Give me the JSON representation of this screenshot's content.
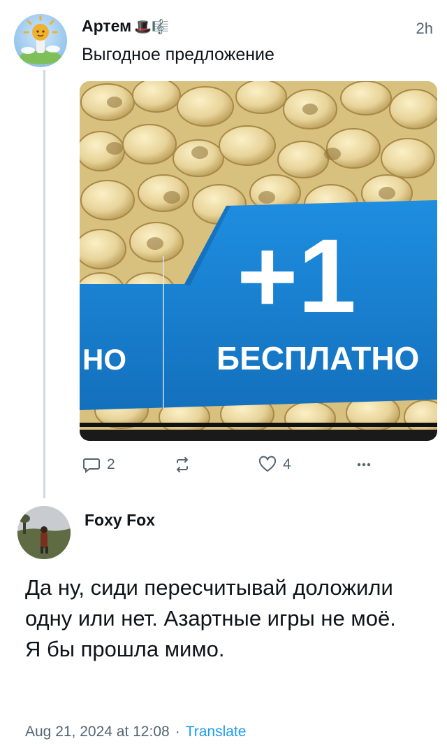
{
  "post": {
    "author": "Артем",
    "author_emoji": "🎩🎼",
    "time": "2h",
    "text": "Выгодное предложение",
    "image": {
      "promo_plus": "+1",
      "promo_label": "БЕСПЛАТНО",
      "promo_left_fragment": "НО",
      "colors": {
        "banner": "#1a82d2",
        "pasta": "#e8d49a"
      }
    },
    "actions": {
      "replies": "2",
      "reposts": "",
      "likes": "4"
    }
  },
  "reply": {
    "author": "Foxy Fox",
    "text": "Да ну, сиди пересчитывай доложили одну или нет. Азартные игры не моё. Я бы прошла мимо.",
    "timestamp": "Aug 21, 2024 at 12:08",
    "separator": "·",
    "translate_label": "Translate"
  },
  "colors": {
    "text_primary": "#0f1419",
    "text_secondary": "#536471",
    "link": "#1d9bf0",
    "thread_line": "#cfd9de"
  }
}
